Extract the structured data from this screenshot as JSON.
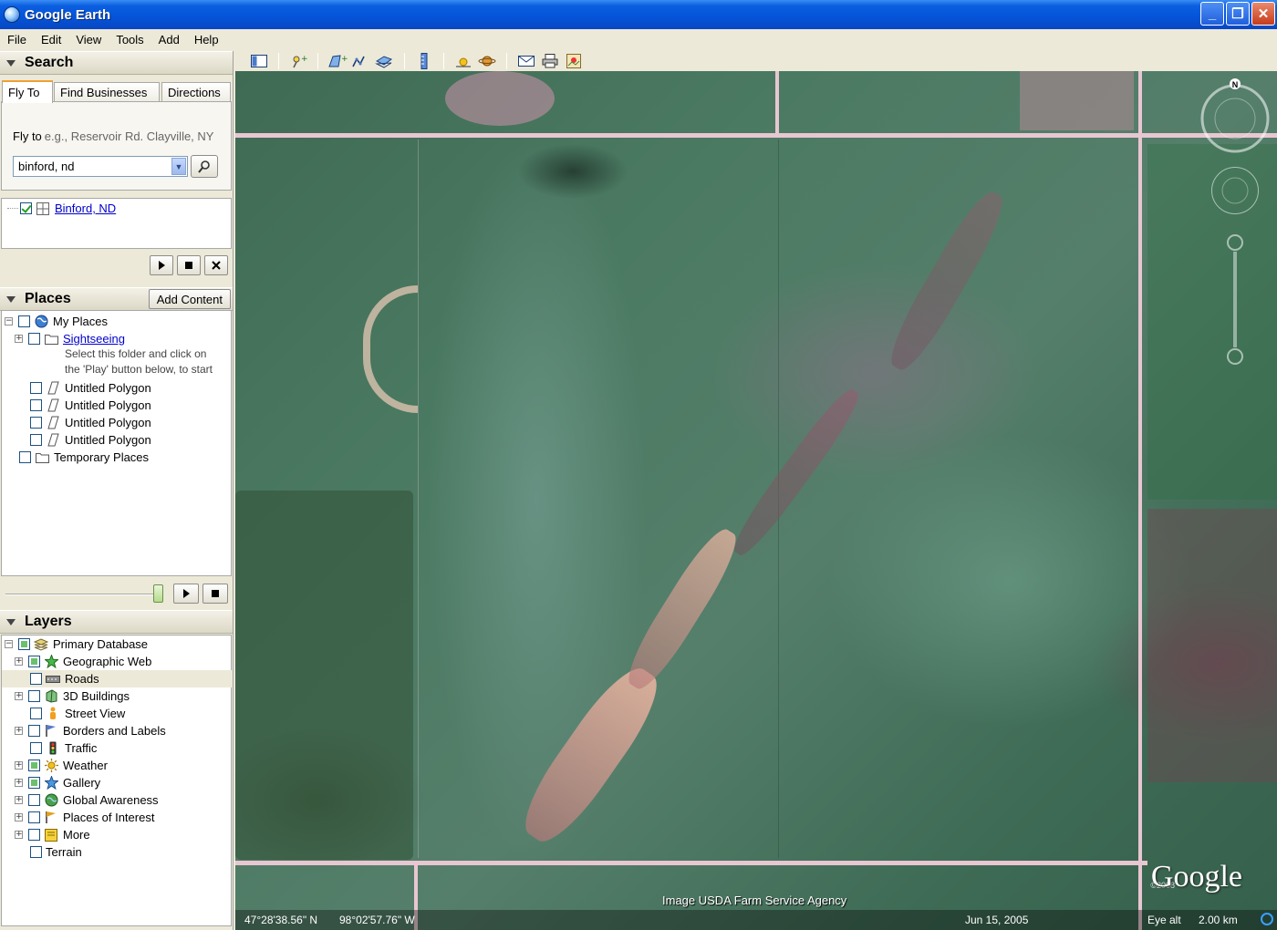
{
  "window": {
    "title": "Google Earth",
    "minimize_glyph": "_",
    "maximize_glyph": "❐",
    "close_glyph": "✕"
  },
  "menu": {
    "file": "File",
    "edit": "Edit",
    "view": "View",
    "tools": "Tools",
    "add": "Add",
    "help": "Help"
  },
  "search": {
    "header": "Search",
    "tabs": [
      "Fly To",
      "Find Businesses",
      "Directions"
    ],
    "fly_to_label": "Fly to",
    "fly_to_hint": "e.g., Reservoir Rd. Clayville, NY",
    "query_value": "binford, nd",
    "results": [
      {
        "label": "Binford, ND",
        "checked": true
      }
    ]
  },
  "places": {
    "header": "Places",
    "add_content": "Add Content",
    "my_places": "My Places",
    "sightseeing": "Sightseeing",
    "sightseeing_desc_1": "Select this folder and click on",
    "sightseeing_desc_2": "the 'Play' button below, to start",
    "polygons": [
      "Untitled Polygon",
      "Untitled Polygon",
      "Untitled Polygon",
      "Untitled Polygon"
    ],
    "temporary": "Temporary Places"
  },
  "layers": {
    "header": "Layers",
    "primary": "Primary Database",
    "items": [
      {
        "label": "Geographic Web",
        "icon": "star-icon",
        "state": "partial",
        "expandable": true
      },
      {
        "label": "Roads",
        "icon": "road-icon",
        "state": "unchecked",
        "expandable": false
      },
      {
        "label": "3D Buildings",
        "icon": "building-icon",
        "state": "unchecked",
        "expandable": true
      },
      {
        "label": "Street View",
        "icon": "person-icon",
        "state": "unchecked",
        "expandable": false
      },
      {
        "label": "Borders and Labels",
        "icon": "flag-icon",
        "state": "unchecked",
        "expandable": true
      },
      {
        "label": "Traffic",
        "icon": "traffic-light-icon",
        "state": "unchecked",
        "expandable": false
      },
      {
        "label": "Weather",
        "icon": "sun-icon",
        "state": "partial",
        "expandable": true
      },
      {
        "label": "Gallery",
        "icon": "star-icon",
        "state": "partial",
        "expandable": true
      },
      {
        "label": "Global Awareness",
        "icon": "globe-icon",
        "state": "unchecked",
        "expandable": true
      },
      {
        "label": "Places of Interest",
        "icon": "flag-icon",
        "state": "unchecked",
        "expandable": true
      },
      {
        "label": "More",
        "icon": "note-icon",
        "state": "unchecked",
        "expandable": true
      }
    ],
    "terrain": "Terrain"
  },
  "map": {
    "north_label": "N",
    "credit": "Image USDA Farm Service Agency",
    "logo": "Google",
    "logo_year": "©2008",
    "latitude": "47°28'38.56\" N",
    "longitude": "98°02'57.76\" W",
    "date": "Jun 15, 2005",
    "eye_alt_label": "Eye alt",
    "eye_alt_value": "2.00 km"
  },
  "colors": {
    "titlebar": "#0553d8",
    "panel_bg": "#ece9d8",
    "link": "#0000cc",
    "road": "#e8c6d2"
  }
}
